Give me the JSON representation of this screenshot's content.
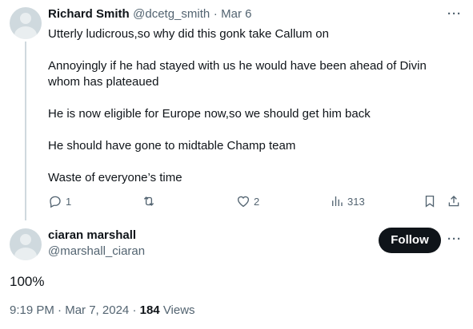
{
  "reply": {
    "author_name": "Richard Smith",
    "handle": "@dcetg_smith",
    "separator": "·",
    "date": "Mar 6",
    "body": [
      "Utterly ludicrous,so why did this gonk take Callum on",
      "",
      "Annoyingly if he had stayed with us he would have been ahead of Divin",
      "whom has plateaued",
      "",
      "He is now eligible for Europe now,so we should get him back",
      "",
      "He should have gone to midtable Champ team",
      "",
      "Waste of everyone’s time"
    ],
    "stats": {
      "replies": "1",
      "reposts": "",
      "likes": "2",
      "views": "313"
    },
    "more_label": "···"
  },
  "main": {
    "author_name": "ciaran marshall",
    "handle": "@marshall_ciaran",
    "follow_label": "Follow",
    "more_label": "···",
    "text": "100%",
    "time": "9:19 PM",
    "date": "Mar 7, 2024",
    "separator": "·",
    "views_count": "184",
    "views_label": "Views"
  },
  "icons": [
    "avatar-placeholder",
    "reply-icon",
    "repost-icon",
    "like-icon",
    "views-icon",
    "bookmark-icon",
    "share-icon",
    "more-icon"
  ],
  "colors": {
    "text": "#0f1419",
    "muted": "#536471",
    "thread_line": "#cfd9de",
    "follow_bg": "#0f1419"
  }
}
